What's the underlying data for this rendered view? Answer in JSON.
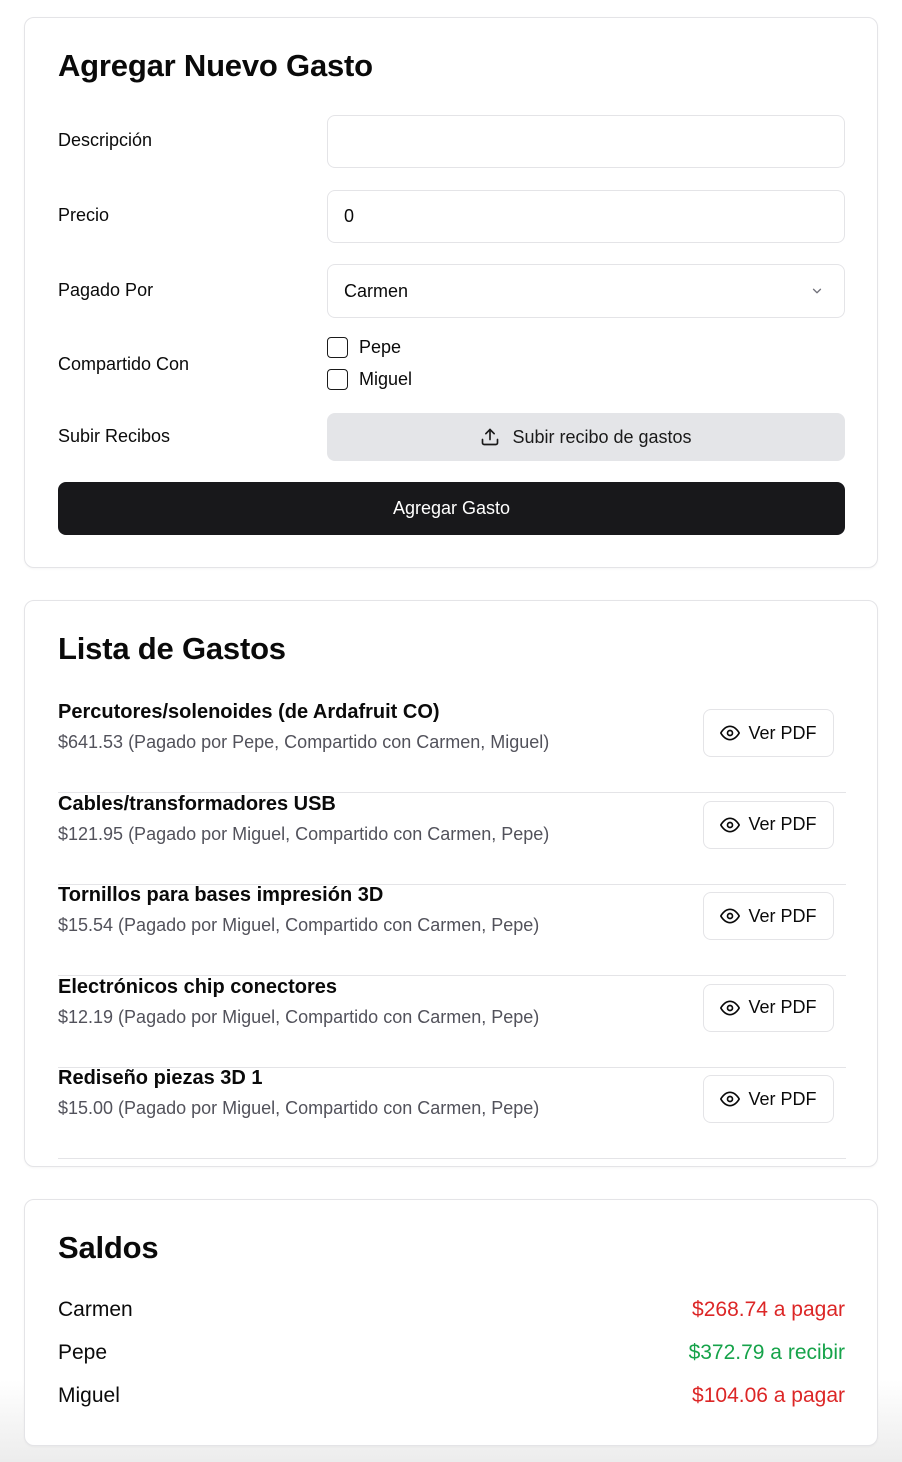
{
  "form": {
    "title": "Agregar Nuevo Gasto",
    "description_label": "Descripción",
    "description_value": "",
    "price_label": "Precio",
    "price_value": "0",
    "paid_by_label": "Pagado Por",
    "paid_by_value": "Carmen",
    "shared_with_label": "Compartido Con",
    "shared_with_options": [
      {
        "label": "Pepe",
        "checked": false
      },
      {
        "label": "Miguel",
        "checked": false
      }
    ],
    "receipts_label": "Subir Recibos",
    "upload_button": "Subir recibo de gastos",
    "submit_button": "Agregar Gasto"
  },
  "list": {
    "title": "Lista de Gastos",
    "pdf_button": "Ver PDF",
    "items": [
      {
        "name": "Percutores/solenoides (de Ardafruit CO)",
        "meta": "$641.53 (Pagado por Pepe, Compartido con Carmen, Miguel)"
      },
      {
        "name": "Cables/transformadores USB",
        "meta": "$121.95 (Pagado por Miguel, Compartido con Carmen, Pepe)"
      },
      {
        "name": "Tornillos para bases impresión 3D",
        "meta": "$15.54 (Pagado por Miguel, Compartido con Carmen, Pepe)"
      },
      {
        "name": "Electrónicos chip conectores",
        "meta": "$12.19 (Pagado por Miguel, Compartido con Carmen, Pepe)"
      },
      {
        "name": "Rediseño piezas 3D 1",
        "meta": "$15.00 (Pagado por Miguel, Compartido con Carmen, Pepe)"
      }
    ]
  },
  "balances": {
    "title": "Saldos",
    "rows": [
      {
        "name": "Carmen",
        "amount": "$268.74 a pagar",
        "status": "owes"
      },
      {
        "name": "Pepe",
        "amount": "$372.79 a recibir",
        "status": "receives"
      },
      {
        "name": "Miguel",
        "amount": "$104.06 a pagar",
        "status": "owes"
      }
    ]
  },
  "colors": {
    "primary_button": "#18181b",
    "owes": "#dc2626",
    "receives": "#16a34a",
    "muted_text": "#52525b",
    "border": "#e4e4e7"
  },
  "icons": {
    "upload": "upload-icon",
    "view": "eye-icon",
    "dropdown": "chevron-down-icon"
  }
}
